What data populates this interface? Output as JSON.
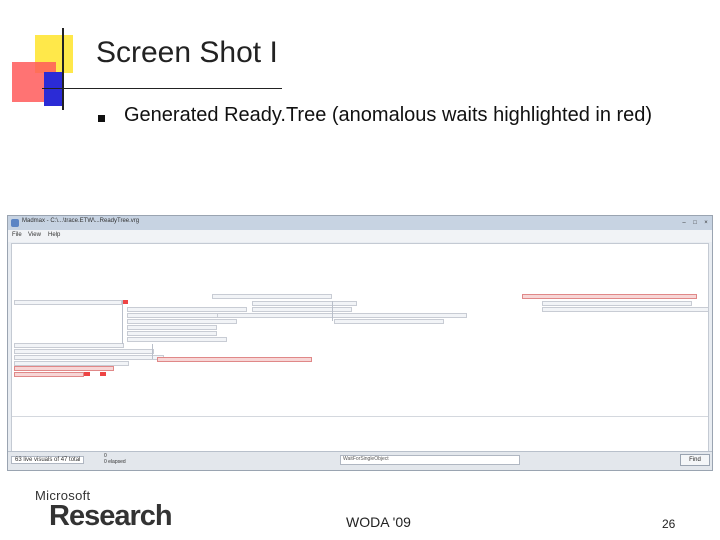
{
  "slide": {
    "title": "Screen Shot I",
    "bullet": "Generated Ready.Tree (anomalous waits highlighted in red)",
    "footer_center": "WODA '09",
    "page_number": "26",
    "logo_top": "Microsoft",
    "logo_bottom": "Research"
  },
  "app": {
    "window_title": "Madmax - C:\\...\\trace.ETW\\...ReadyTree.vrg",
    "menu": [
      "File",
      "View",
      "Help"
    ],
    "status": "63 live visuals of 47 total",
    "zoom_line1": "0",
    "zoom_line2": "0 elapsed",
    "find_value": "WaitForSingleObject",
    "find_label": "Find",
    "window_buttons": [
      "–",
      "□",
      "×"
    ]
  },
  "colors": {
    "accent_red": "#e44444",
    "row_fill": "#f2f4f7",
    "row_red": "#f7d6d6"
  }
}
